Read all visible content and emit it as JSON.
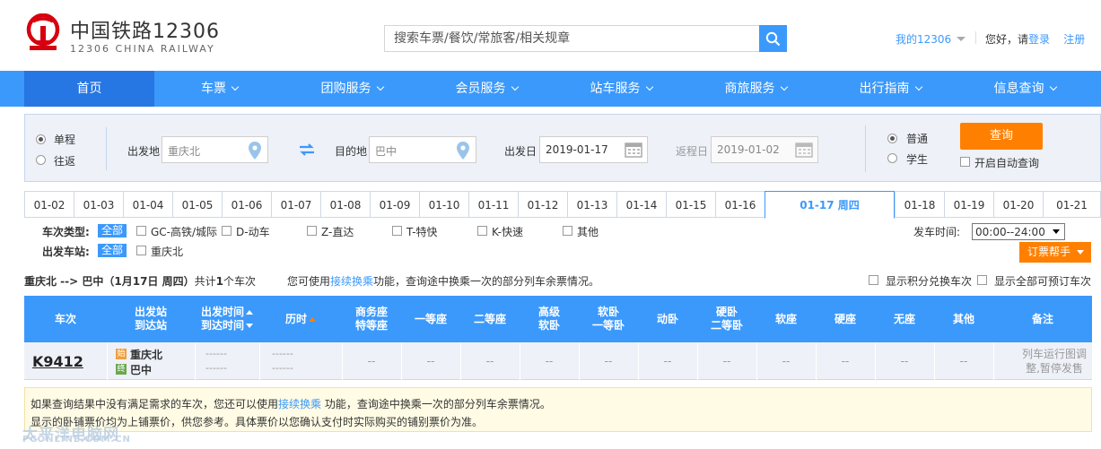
{
  "header": {
    "brand_cn": "中国铁路12306",
    "brand_en": "12306 CHINA RAILWAY",
    "search_placeholder": "搜索车票/餐饮/常旅客/相关规章",
    "my_account": "我的12306",
    "greeting": "您好，请",
    "login": "登录",
    "register": "注册",
    "brand_color": "#3b99fc",
    "logo_color": "#d7000f"
  },
  "nav": {
    "items": [
      "首页",
      "车票",
      "团购服务",
      "会员服务",
      "站车服务",
      "商旅服务",
      "出行指南",
      "信息查询"
    ]
  },
  "query": {
    "one_way": "单程",
    "round_trip": "往返",
    "from_label": "出发地",
    "from_value": "重庆北",
    "to_label": "目的地",
    "to_value": "巴中",
    "depart_label": "出发日",
    "depart_value": "2019-01-17",
    "return_label": "返程日",
    "return_value": "2019-01-02",
    "normal": "普通",
    "student": "学生",
    "search_button": "查询",
    "auto_query": "开启自动查询"
  },
  "dates": [
    "01-02",
    "01-03",
    "01-04",
    "01-05",
    "01-06",
    "01-07",
    "01-08",
    "01-09",
    "01-10",
    "01-11",
    "01-12",
    "01-13",
    "01-14",
    "01-15",
    "01-16",
    "01-17 周四",
    "01-18",
    "01-19",
    "01-20",
    "01-21"
  ],
  "selected_date": "01-17 周四",
  "filters": {
    "type_label": "车次类型:",
    "all": "全部",
    "types": [
      "GC-高铁/城际",
      "D-动车",
      "Z-直达",
      "T-特快",
      "K-快速",
      "其他"
    ],
    "station_label": "出发车站:",
    "stations": [
      "重庆北"
    ],
    "depart_time_label": "发车时间:",
    "depart_time_value": "00:00--24:00",
    "help_button": "订票帮手"
  },
  "summary": {
    "route": "重庆北 --> 巴中（1月17日  周四）",
    "count_text": "共计",
    "count": "1",
    "count_suffix": "个车次",
    "transfer_pre": "您可使用",
    "transfer_link": "接续换乘",
    "transfer_post": "功能，查询途中换乘一次的部分列车余票情况。",
    "show_points": "显示积分兑换车次",
    "show_all": "显示全部可预订车次"
  },
  "table": {
    "headers": {
      "train": "车次",
      "stations_1": "出发站",
      "stations_2": "到达站",
      "times_1": "出发时间",
      "times_2": "到达时间",
      "duration": "历时",
      "business_1": "商务座",
      "business_2": "特等座",
      "first": "一等座",
      "second": "二等座",
      "senior_1": "高级",
      "senior_2": "软卧",
      "soft_1": "软卧",
      "soft_2": "一等卧",
      "moving": "动卧",
      "hard_1": "硬卧",
      "hard_2": "二等卧",
      "soft_seat": "软座",
      "hard_seat": "硬座",
      "standing": "无座",
      "other": "其他",
      "remarks": "备注"
    },
    "row": {
      "train_no": "K9412",
      "start_badge": "始",
      "end_badge": "终",
      "from": "重庆北",
      "to": "巴中",
      "dashes": "------",
      "seat": "--",
      "remark": "列车运行图调整,暂停发售"
    }
  },
  "tip": {
    "line1_pre": "如果查询结果中没有满足需求的车次，您还可以使用",
    "line1_link": "接续换乘",
    "line1_post": " 功能，查询途中换乘一次的部分列车余票情况。",
    "line2": "显示的卧铺票价均为上铺票价，供您参考。具体票价以您确认支付时实际购买的铺别票价为准。"
  },
  "watermark": {
    "main": "太平洋电脑网",
    "sub": "PCONLINE.COM.CN"
  }
}
